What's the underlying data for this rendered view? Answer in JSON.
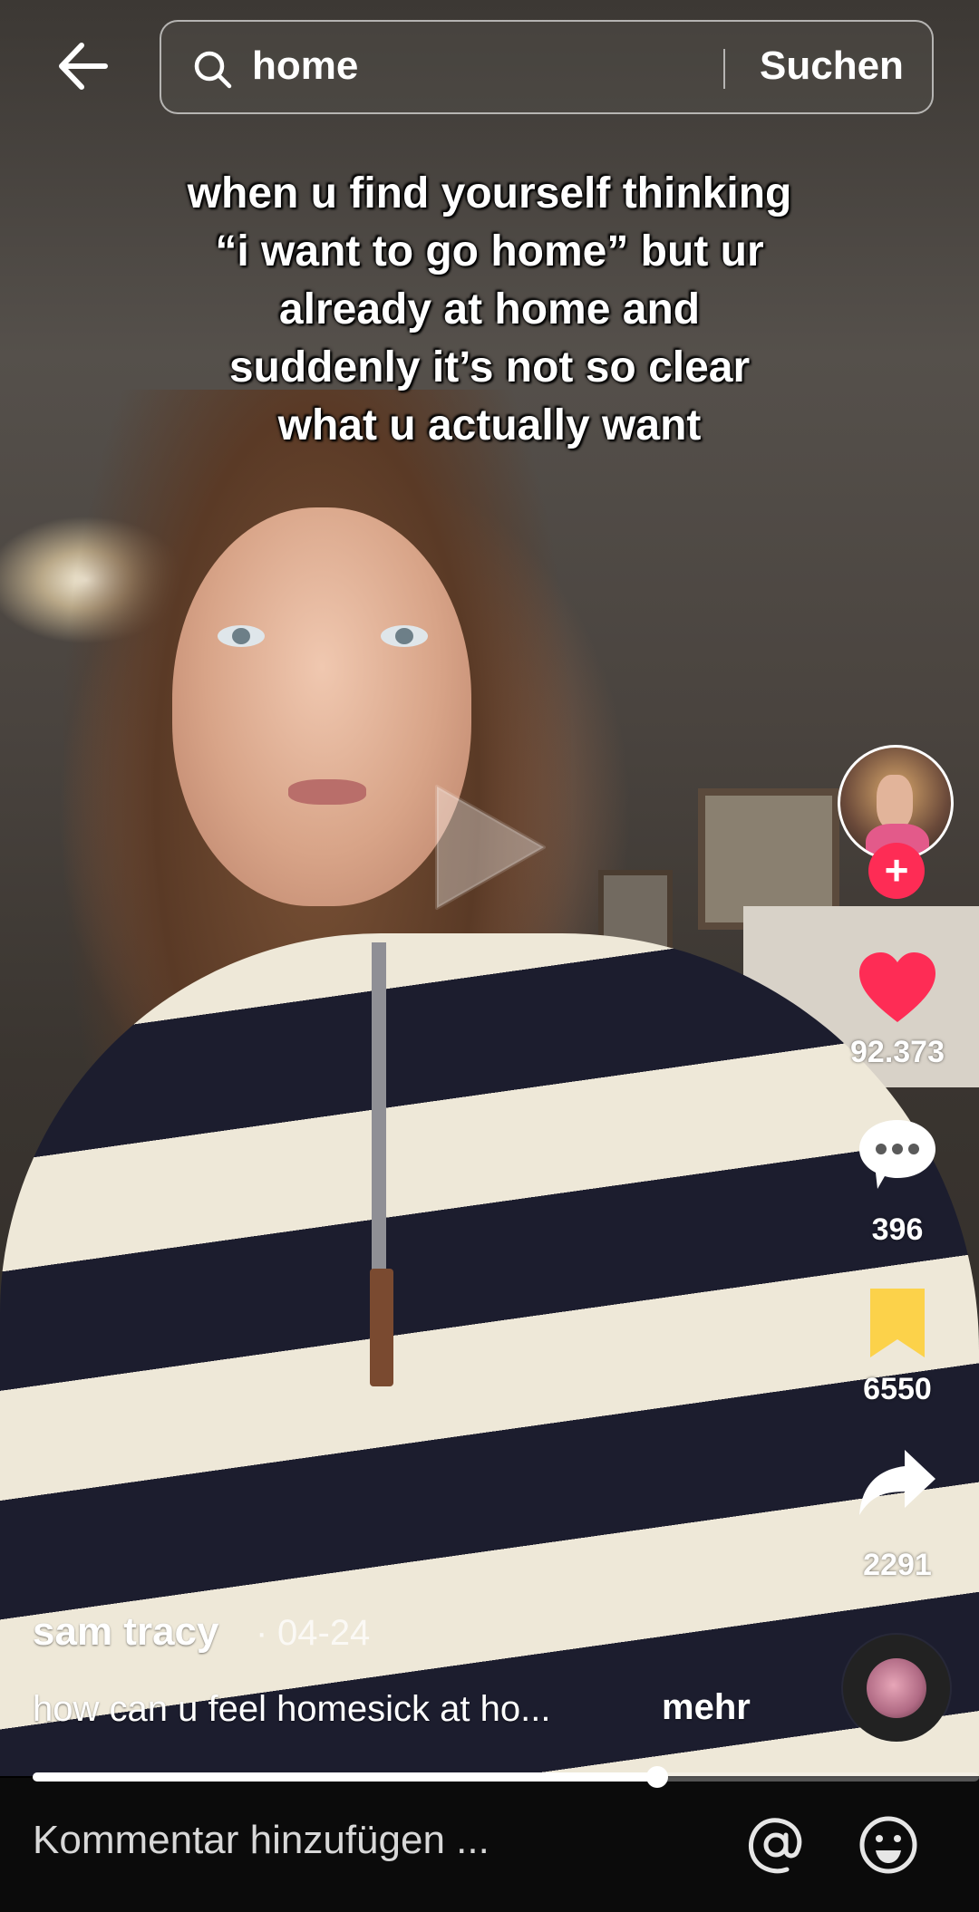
{
  "search": {
    "query": "home",
    "button_label": "Suchen"
  },
  "video": {
    "caption": "when u find yourself thinking “i want to go home” but ur already at home and suddenly it’s not so clear what u actually want",
    "progress_percent": 66
  },
  "actions": {
    "likes": "92.373",
    "comments": "396",
    "bookmarks": "6550",
    "shares": "2291"
  },
  "author": {
    "username": "sam tracy",
    "separator": "·",
    "date": "04-24",
    "description": "how can u feel homesick at ho...",
    "more_label": "mehr"
  },
  "comment_bar": {
    "placeholder": "Kommentar hinzufügen ..."
  },
  "colors": {
    "like_red": "#fe2c55",
    "bookmark_yellow": "#fcd24a"
  },
  "icons": [
    "back-arrow-icon",
    "search-icon",
    "play-icon",
    "heart-icon",
    "comment-bubble-icon",
    "bookmark-icon",
    "share-arrow-icon",
    "at-icon",
    "emoji-icon"
  ]
}
